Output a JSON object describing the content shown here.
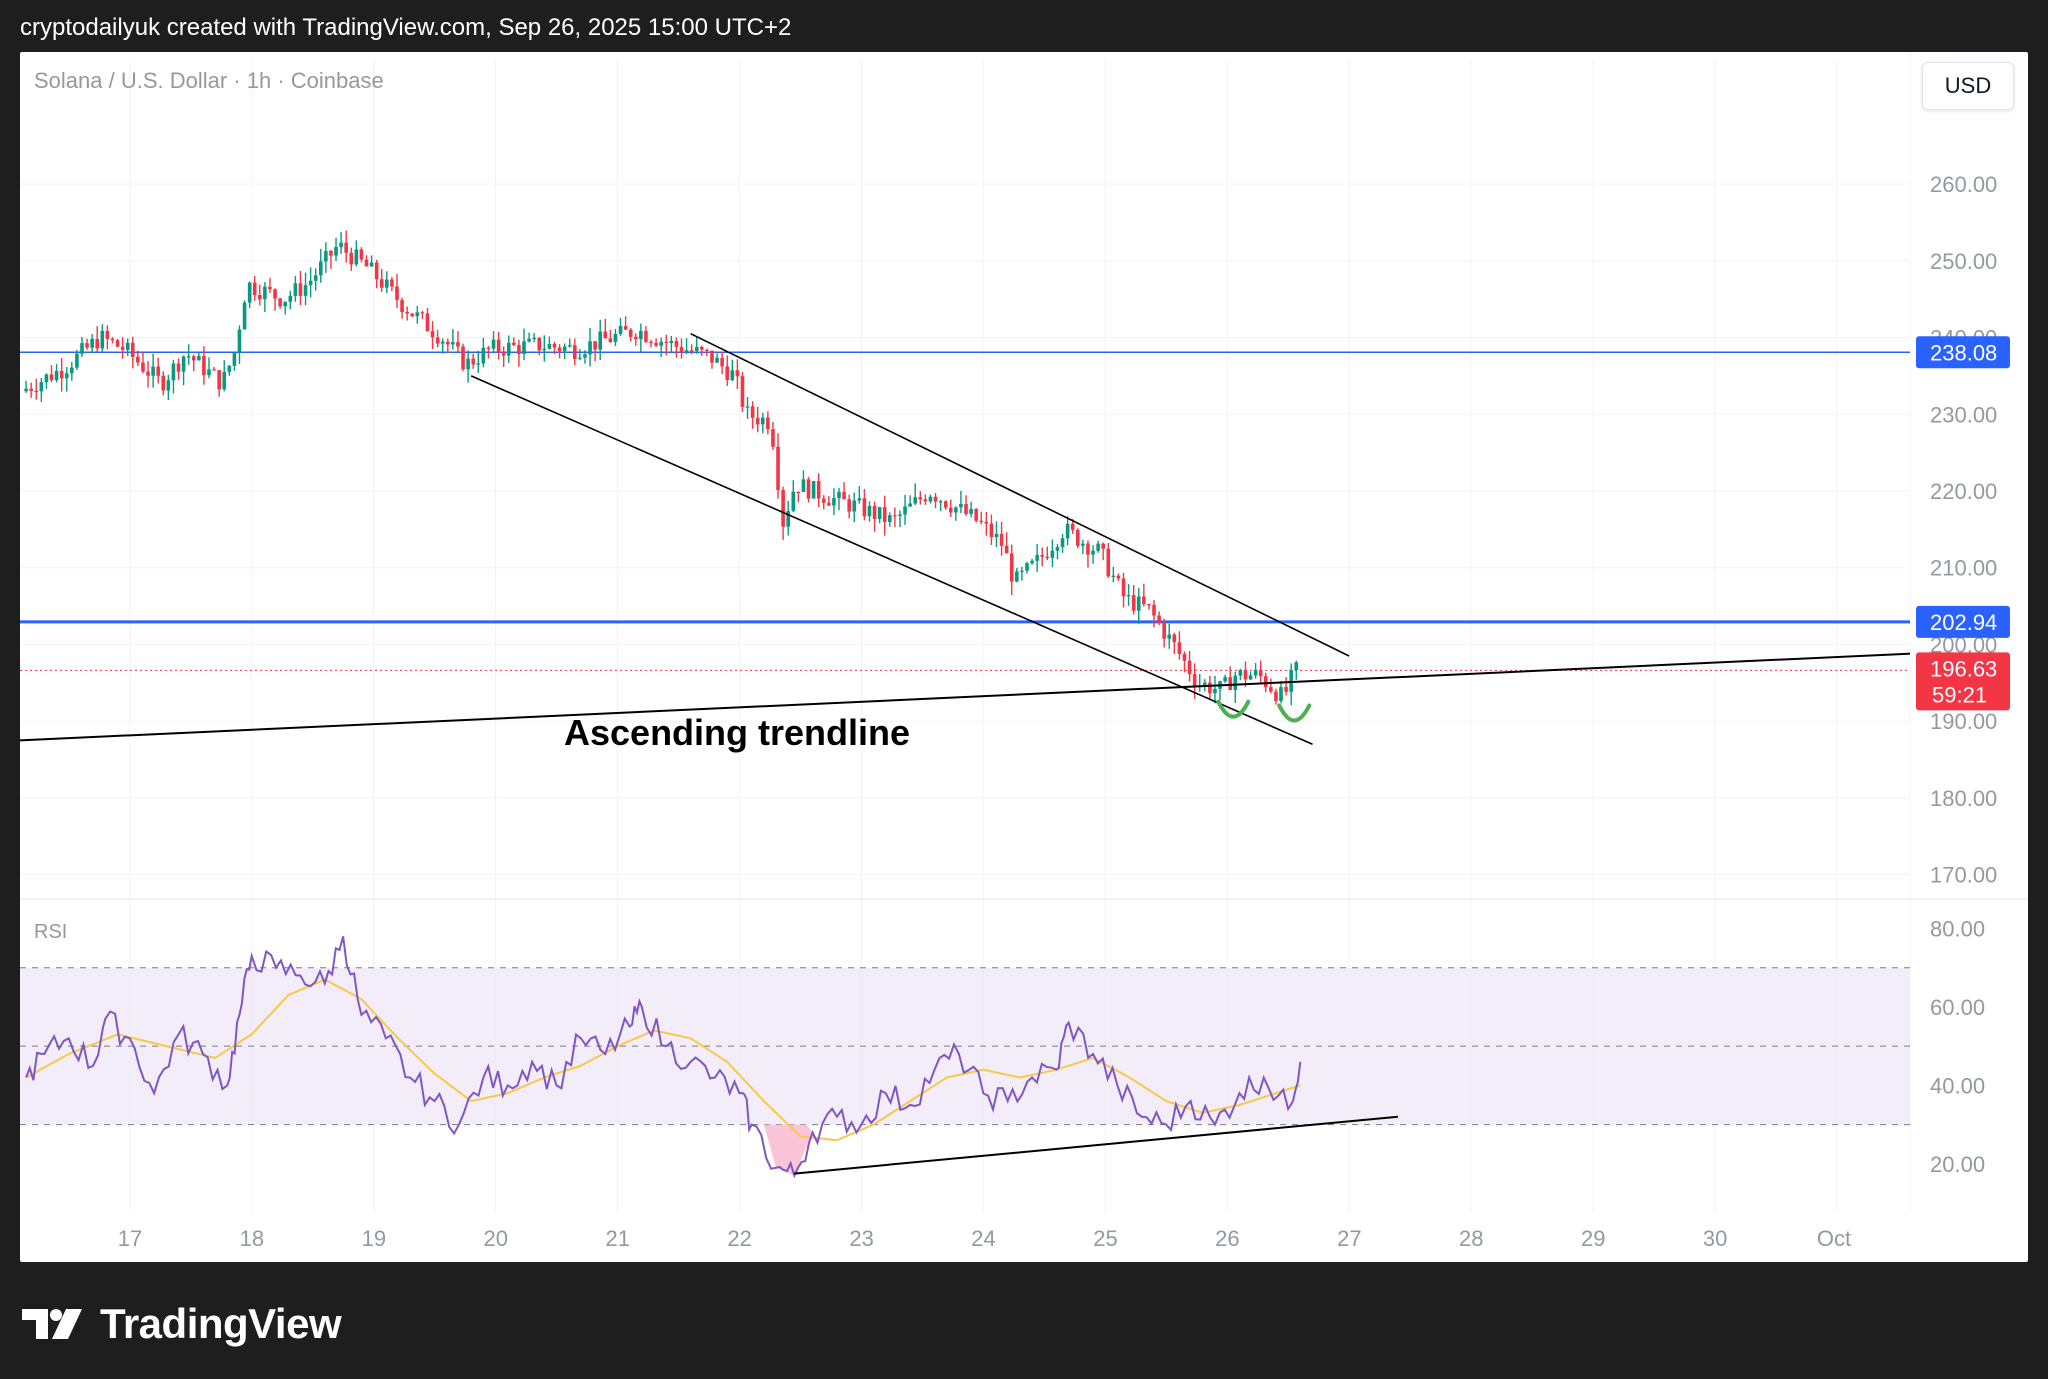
{
  "header": {
    "credit": "cryptodailyuk created with TradingView.com, Sep 26, 2025 15:00 UTC+2"
  },
  "chart_header": {
    "symbol": "Solana / U.S. Dollar · 1h · Coinbase",
    "currency_button": "USD"
  },
  "footer": {
    "brand": "TradingView"
  },
  "colors": {
    "up": "#089981",
    "down": "#f23645",
    "hline": "#2962ff",
    "rsi": "#7e57c2",
    "rsi_ma": "#f7c948",
    "band_fill": "#ede7f6"
  },
  "chart_data": [
    {
      "type": "candlestick",
      "title": "Solana / U.S. Dollar · 1h · Coinbase",
      "x_ticks": [
        "17",
        "18",
        "19",
        "20",
        "21",
        "22",
        "23",
        "24",
        "25",
        "26",
        "27",
        "28",
        "29",
        "30",
        "Oct"
      ],
      "y_ticks": [
        "260.00",
        "250.00",
        "240.00",
        "230.00",
        "220.00",
        "210.00",
        "200.00",
        "190.00",
        "180.00",
        "170.00"
      ],
      "ylim": [
        168,
        272
      ],
      "xlim": [
        16.1,
        31.6
      ],
      "current_price": "196.63",
      "countdown": "59:21",
      "horizontal_levels": [
        {
          "value": 238.08,
          "label": "238.08"
        },
        {
          "value": 202.94,
          "label": "202.94"
        }
      ],
      "price_path": [
        [
          16.15,
          233.0
        ],
        [
          16.5,
          236.0
        ],
        [
          16.8,
          240.0
        ],
        [
          17.0,
          238.5
        ],
        [
          17.3,
          234.0
        ],
        [
          17.5,
          238.0
        ],
        [
          17.8,
          234.0
        ],
        [
          17.9,
          238.0
        ],
        [
          18.0,
          247.0
        ],
        [
          18.3,
          245.0
        ],
        [
          18.5,
          247.0
        ],
        [
          18.75,
          252.0
        ],
        [
          19.0,
          249.0
        ],
        [
          19.3,
          244.0
        ],
        [
          19.6,
          240.0
        ],
        [
          19.8,
          236.5
        ],
        [
          20.0,
          238.5
        ],
        [
          20.4,
          239.0
        ],
        [
          20.7,
          238.5
        ],
        [
          21.0,
          240.0
        ],
        [
          21.2,
          241.0
        ],
        [
          21.5,
          239.0
        ],
        [
          21.8,
          237.5
        ],
        [
          22.0,
          235.0
        ],
        [
          22.1,
          230.0
        ],
        [
          22.3,
          229.0
        ],
        [
          22.4,
          216.0
        ],
        [
          22.5,
          221.0
        ],
        [
          22.8,
          219.0
        ],
        [
          23.0,
          218.0
        ],
        [
          23.3,
          216.0
        ],
        [
          23.6,
          220.0
        ],
        [
          23.8,
          218.0
        ],
        [
          24.0,
          216.0
        ],
        [
          24.2,
          213.0
        ],
        [
          24.3,
          208.0
        ],
        [
          24.5,
          211.0
        ],
        [
          24.7,
          215.0
        ],
        [
          25.0,
          212.0
        ],
        [
          25.2,
          206.0
        ],
        [
          25.4,
          204.5
        ],
        [
          25.6,
          200.0
        ],
        [
          25.8,
          195.0
        ],
        [
          26.0,
          194.0
        ],
        [
          26.1,
          196.0
        ],
        [
          26.3,
          196.0
        ],
        [
          26.5,
          193.0
        ],
        [
          26.6,
          196.6
        ]
      ],
      "annotations": {
        "text": "Ascending trendline",
        "ascending_trendline": [
          [
            16.1,
            187.5
          ],
          [
            31.6,
            198.8
          ]
        ],
        "channel_upper": [
          [
            21.6,
            240.5
          ],
          [
            27.0,
            198.5
          ]
        ],
        "channel_lower": [
          [
            19.8,
            235.0
          ],
          [
            26.7,
            187.0
          ]
        ],
        "double_bottom_markers": [
          [
            26.05,
            191.5
          ],
          [
            26.55,
            191.0
          ]
        ]
      }
    },
    {
      "type": "line",
      "title": "RSI",
      "y_ticks": [
        "80.00",
        "60.00",
        "40.00",
        "20.00"
      ],
      "ylim": [
        10,
        86
      ],
      "bands": {
        "upper": 70,
        "middle": 50,
        "lower": 30
      },
      "rsi_path": [
        [
          16.15,
          42
        ],
        [
          16.3,
          48
        ],
        [
          16.5,
          52
        ],
        [
          16.7,
          45
        ],
        [
          16.8,
          57
        ],
        [
          17.0,
          52
        ],
        [
          17.2,
          38
        ],
        [
          17.4,
          53
        ],
        [
          17.6,
          48
        ],
        [
          17.8,
          40
        ],
        [
          17.9,
          58
        ],
        [
          18.0,
          73
        ],
        [
          18.2,
          70
        ],
        [
          18.4,
          68
        ],
        [
          18.6,
          66
        ],
        [
          18.75,
          78
        ],
        [
          18.9,
          58
        ],
        [
          19.1,
          52
        ],
        [
          19.3,
          42
        ],
        [
          19.5,
          36
        ],
        [
          19.7,
          30
        ],
        [
          19.9,
          42
        ],
        [
          20.1,
          40
        ],
        [
          20.3,
          46
        ],
        [
          20.5,
          40
        ],
        [
          20.7,
          52
        ],
        [
          20.9,
          48
        ],
        [
          21.1,
          55
        ],
        [
          21.2,
          60
        ],
        [
          21.4,
          50
        ],
        [
          21.6,
          46
        ],
        [
          21.8,
          42
        ],
        [
          22.0,
          38
        ],
        [
          22.1,
          30
        ],
        [
          22.3,
          19
        ],
        [
          22.45,
          17
        ],
        [
          22.6,
          28
        ],
        [
          22.8,
          32
        ],
        [
          23.0,
          30
        ],
        [
          23.2,
          38
        ],
        [
          23.4,
          35
        ],
        [
          23.6,
          44
        ],
        [
          23.8,
          48
        ],
        [
          24.0,
          38
        ],
        [
          24.2,
          36
        ],
        [
          24.4,
          42
        ],
        [
          24.6,
          44
        ],
        [
          24.7,
          56
        ],
        [
          24.9,
          48
        ],
        [
          25.1,
          40
        ],
        [
          25.3,
          32
        ],
        [
          25.5,
          30
        ],
        [
          25.7,
          36
        ],
        [
          25.9,
          30
        ],
        [
          26.1,
          38
        ],
        [
          26.3,
          42
        ],
        [
          26.5,
          34
        ],
        [
          26.6,
          46
        ]
      ],
      "rsi_ma_path": [
        [
          16.15,
          42
        ],
        [
          16.5,
          48
        ],
        [
          16.9,
          53
        ],
        [
          17.3,
          50
        ],
        [
          17.7,
          47
        ],
        [
          18.0,
          53
        ],
        [
          18.3,
          63
        ],
        [
          18.6,
          67
        ],
        [
          18.9,
          62
        ],
        [
          19.2,
          52
        ],
        [
          19.5,
          43
        ],
        [
          19.8,
          36
        ],
        [
          20.1,
          38
        ],
        [
          20.4,
          42
        ],
        [
          20.7,
          45
        ],
        [
          21.0,
          50
        ],
        [
          21.3,
          54
        ],
        [
          21.6,
          52
        ],
        [
          21.9,
          46
        ],
        [
          22.2,
          36
        ],
        [
          22.5,
          27
        ],
        [
          22.8,
          26
        ],
        [
          23.1,
          30
        ],
        [
          23.4,
          36
        ],
        [
          23.7,
          42
        ],
        [
          24.0,
          44
        ],
        [
          24.3,
          42
        ],
        [
          24.6,
          44
        ],
        [
          24.9,
          47
        ],
        [
          25.2,
          42
        ],
        [
          25.5,
          36
        ],
        [
          25.8,
          33
        ],
        [
          26.1,
          35
        ],
        [
          26.4,
          38
        ],
        [
          26.6,
          40
        ]
      ],
      "support_line": [
        [
          22.45,
          17.5
        ],
        [
          27.4,
          32.0
        ]
      ]
    }
  ]
}
